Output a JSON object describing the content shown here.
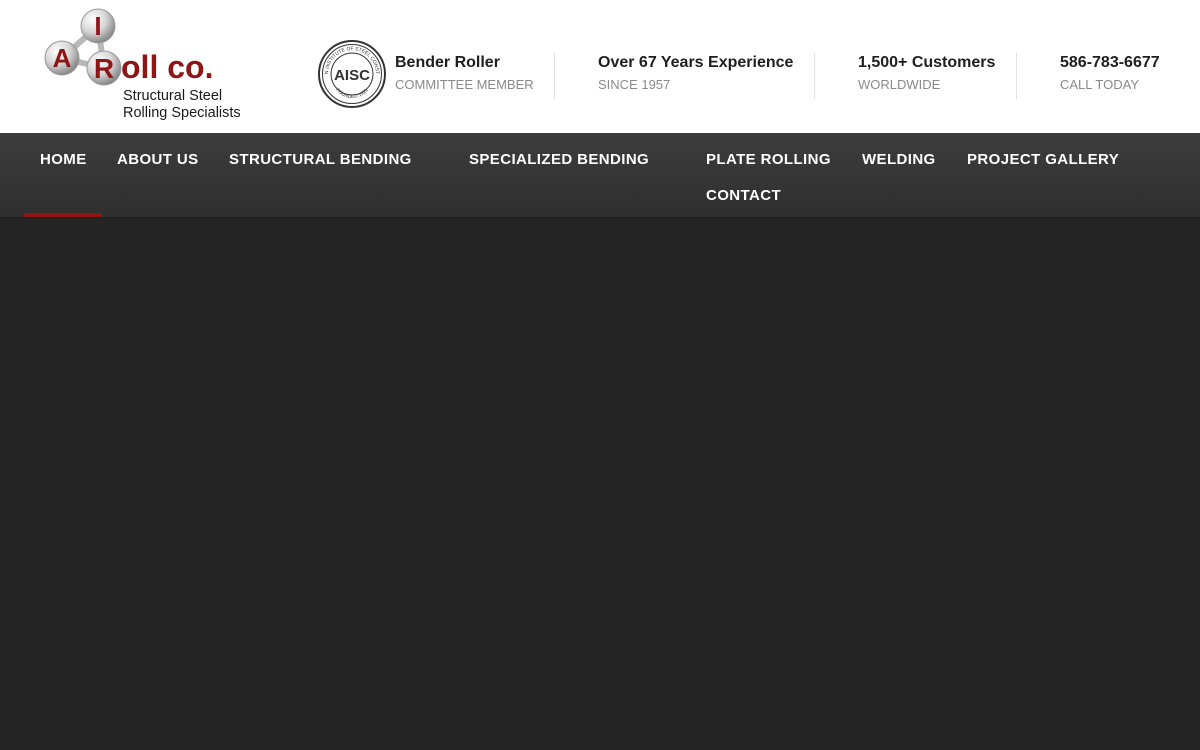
{
  "brand": {
    "name": "A-1 Roll Co.",
    "logo_letters": [
      "I",
      "A",
      "R"
    ],
    "logo_word": "oll co.",
    "tagline_line1": "Structural Steel",
    "tagline_line2": "Rolling Specialists",
    "accent_color": "#8d1515"
  },
  "badge": {
    "seal_text": "AMERICAN INSTITUTE OF STEEL CONSTRUCTION",
    "seal_letters": "AISC",
    "seal_founded": "FOUNDED 1921"
  },
  "header_info": [
    {
      "title": "Bender Roller",
      "subtitle": "COMMITTEE MEMBER"
    },
    {
      "title": "Over 67 Years Experience",
      "subtitle": "SINCE 1957"
    },
    {
      "title": "1,500+ Customers",
      "subtitle": "WORLDWIDE"
    },
    {
      "title": "586-783-6677",
      "subtitle": "CALL TODAY"
    }
  ],
  "nav": {
    "items": [
      {
        "label": "HOME",
        "active": true
      },
      {
        "label": "ABOUT US"
      },
      {
        "label": "STRUCTURAL BENDING"
      },
      {
        "label": "SPECIALIZED BENDING"
      },
      {
        "label": "PLATE ROLLING"
      },
      {
        "label": "WELDING"
      },
      {
        "label": "PROJECT GALLERY"
      },
      {
        "label": "CONTACT"
      }
    ]
  }
}
